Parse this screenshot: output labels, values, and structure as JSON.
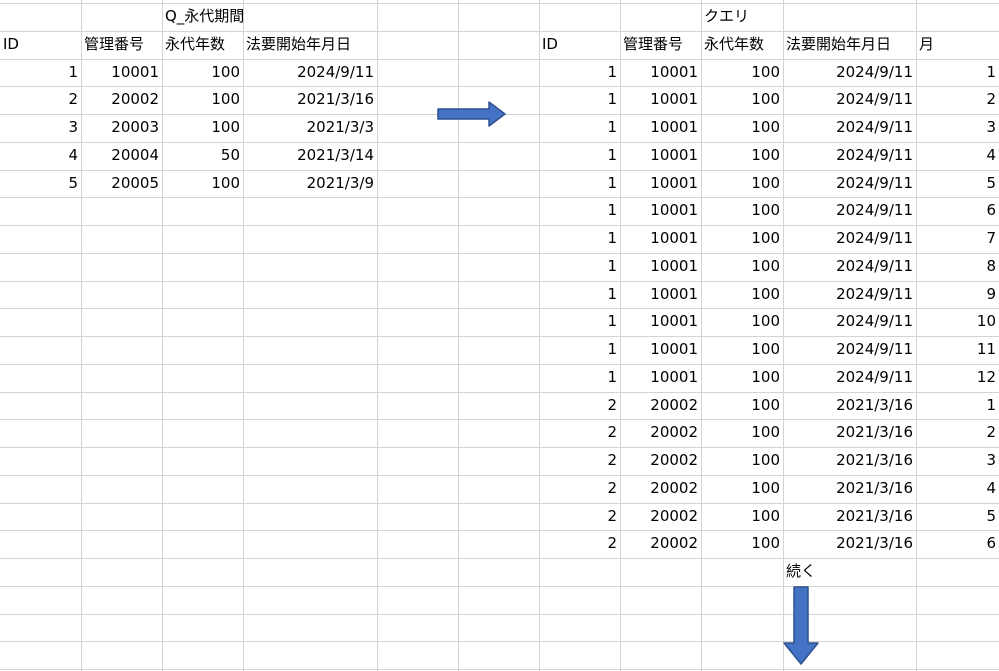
{
  "left_table": {
    "title": "Q_永代期間",
    "headers": [
      "ID",
      "管理番号",
      "永代年数",
      "法要開始年月日"
    ],
    "rows": [
      [
        "1",
        "10001",
        "100",
        "2024/9/11"
      ],
      [
        "2",
        "20002",
        "100",
        "2021/3/16"
      ],
      [
        "3",
        "20003",
        "100",
        "2021/3/3"
      ],
      [
        "4",
        "20004",
        "50",
        "2021/3/14"
      ],
      [
        "5",
        "20005",
        "100",
        "2021/3/9"
      ]
    ]
  },
  "right_table": {
    "title": "クエリ",
    "headers": [
      "ID",
      "管理番号",
      "永代年数",
      "法要開始年月日",
      "月"
    ],
    "rows": [
      [
        "1",
        "10001",
        "100",
        "2024/9/11",
        "1"
      ],
      [
        "1",
        "10001",
        "100",
        "2024/9/11",
        "2"
      ],
      [
        "1",
        "10001",
        "100",
        "2024/9/11",
        "3"
      ],
      [
        "1",
        "10001",
        "100",
        "2024/9/11",
        "4"
      ],
      [
        "1",
        "10001",
        "100",
        "2024/9/11",
        "5"
      ],
      [
        "1",
        "10001",
        "100",
        "2024/9/11",
        "6"
      ],
      [
        "1",
        "10001",
        "100",
        "2024/9/11",
        "7"
      ],
      [
        "1",
        "10001",
        "100",
        "2024/9/11",
        "8"
      ],
      [
        "1",
        "10001",
        "100",
        "2024/9/11",
        "9"
      ],
      [
        "1",
        "10001",
        "100",
        "2024/9/11",
        "10"
      ],
      [
        "1",
        "10001",
        "100",
        "2024/9/11",
        "11"
      ],
      [
        "1",
        "10001",
        "100",
        "2024/9/11",
        "12"
      ],
      [
        "2",
        "20002",
        "100",
        "2021/3/16",
        "1"
      ],
      [
        "2",
        "20002",
        "100",
        "2021/3/16",
        "2"
      ],
      [
        "2",
        "20002",
        "100",
        "2021/3/16",
        "3"
      ],
      [
        "2",
        "20002",
        "100",
        "2021/3/16",
        "4"
      ],
      [
        "2",
        "20002",
        "100",
        "2021/3/16",
        "5"
      ],
      [
        "2",
        "20002",
        "100",
        "2021/3/16",
        "6"
      ]
    ],
    "continue_note": "続く"
  },
  "arrows": {
    "right": "arrow-right-icon",
    "down": "arrow-down-icon",
    "fill_color": "#4472c4",
    "stroke_color": "#2f528f"
  },
  "colors": {
    "gridline": "#d4d4d4",
    "text": "#000000",
    "background": "#ffffff"
  }
}
